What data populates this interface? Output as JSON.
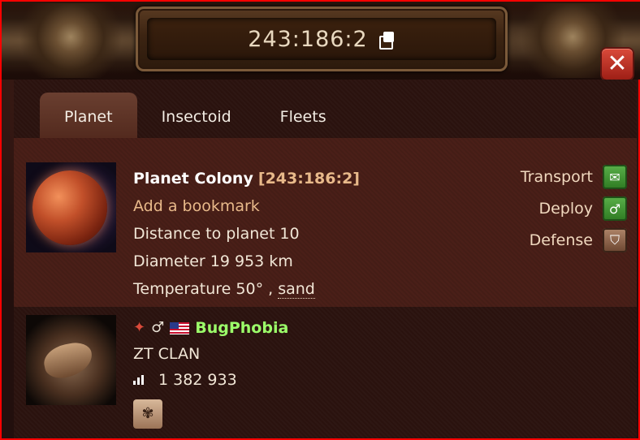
{
  "header": {
    "coordinates": "243:186:2",
    "copy_icon": "copy-icon",
    "close_icon": "close-icon"
  },
  "tabs": [
    {
      "label": "Planet",
      "active": true
    },
    {
      "label": "Insectoid",
      "active": false
    },
    {
      "label": "Fleets",
      "active": false
    }
  ],
  "planet": {
    "name": "Planet Colony",
    "coords": "[243:186:2]",
    "bookmark_label": "Add a bookmark",
    "distance": "Distance to planet 10",
    "diameter": "Diameter 19 953 km",
    "temperature": "Temperature 50° ,",
    "terrain": "sand"
  },
  "actions": [
    {
      "label": "Transport",
      "icon": "transport-icon"
    },
    {
      "label": "Deploy",
      "icon": "deploy-icon"
    },
    {
      "label": "Defense",
      "icon": "defense-icon"
    }
  ],
  "player": {
    "name": "BugPhobia",
    "clan": "ZT CLAN",
    "score": "1 382 933",
    "status_icons": [
      "fire-icon",
      "male-icon",
      "us-flag-icon"
    ],
    "badge_icon": "insect-badge-icon"
  },
  "colors": {
    "frame_border": "#ff0000",
    "player_name": "#9cff6a",
    "link": "#e8b98a",
    "close_button": "#c23a2c"
  }
}
